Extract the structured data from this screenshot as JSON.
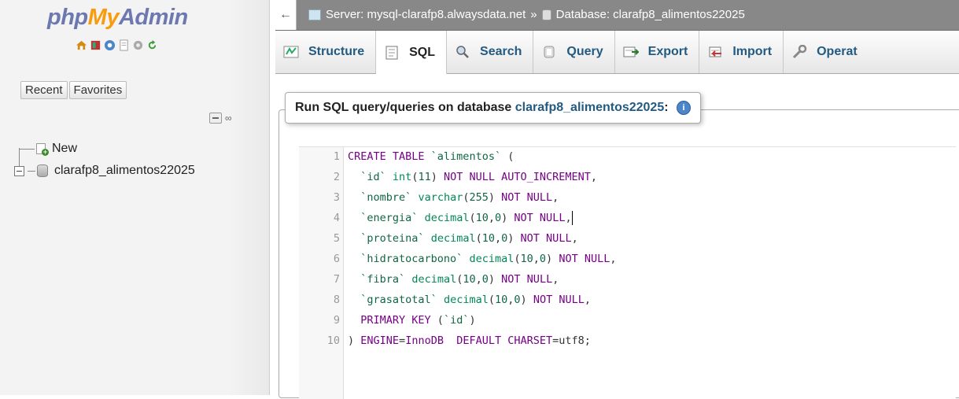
{
  "app": {
    "logo_php": "php",
    "logo_my": "My",
    "logo_admin": "Admin"
  },
  "nav": {
    "icons": [
      "home-icon",
      "database-icon",
      "help-icon",
      "docs-icon",
      "settings-icon",
      "reload-icon"
    ],
    "tabs": [
      {
        "label": "Recent"
      },
      {
        "label": "Favorites"
      }
    ],
    "tree": [
      {
        "label": "New"
      },
      {
        "label": "clarafp8_alimentos22025"
      }
    ]
  },
  "breadcrumb": {
    "server": "Server: mysql-clarafp8.alwaysdata.net",
    "sep": "»",
    "database": "Database: clarafp8_alimentos22025"
  },
  "tabs": [
    {
      "label": "Structure",
      "icon": "structure-icon"
    },
    {
      "label": "SQL",
      "icon": "sql-icon",
      "active": true
    },
    {
      "label": "Search",
      "icon": "search-icon"
    },
    {
      "label": "Query",
      "icon": "query-icon"
    },
    {
      "label": "Export",
      "icon": "export-icon"
    },
    {
      "label": "Import",
      "icon": "import-icon"
    },
    {
      "label": "Operat",
      "icon": "operations-icon"
    }
  ],
  "query_panel": {
    "legend_prefix": "Run SQL query/queries on database ",
    "legend_db": "clarafp8_alimentos22025",
    "legend_suffix": ":"
  },
  "code": [
    {
      "n": "1",
      "parts": [
        [
          "kw",
          "CREATE TABLE "
        ],
        [
          "str",
          "`alimentos`"
        ],
        [
          "pn",
          " ("
        ]
      ]
    },
    {
      "n": "2",
      "parts": [
        [
          "pn",
          "  "
        ],
        [
          "str",
          "`id`"
        ],
        [
          "pn",
          " "
        ],
        [
          "ty",
          "int"
        ],
        [
          "pn",
          "("
        ],
        [
          "num",
          "11"
        ],
        [
          "pn",
          ") "
        ],
        [
          "kw",
          "NOT NULL AUTO_INCREMENT"
        ],
        [
          "pn",
          ","
        ]
      ]
    },
    {
      "n": "3",
      "parts": [
        [
          "pn",
          "  "
        ],
        [
          "str",
          "`nombre`"
        ],
        [
          "pn",
          " "
        ],
        [
          "ty",
          "varchar"
        ],
        [
          "pn",
          "("
        ],
        [
          "num",
          "255"
        ],
        [
          "pn",
          ") "
        ],
        [
          "kw",
          "NOT NULL"
        ],
        [
          "pn",
          ","
        ]
      ]
    },
    {
      "n": "4",
      "parts": [
        [
          "pn",
          "  "
        ],
        [
          "str",
          "`energia`"
        ],
        [
          "pn",
          " "
        ],
        [
          "ty",
          "decimal"
        ],
        [
          "pn",
          "("
        ],
        [
          "num",
          "10"
        ],
        [
          "pn",
          ","
        ],
        [
          "num",
          "0"
        ],
        [
          "pn",
          ") "
        ],
        [
          "kw",
          "NOT NULL"
        ],
        [
          "pn",
          ","
        ]
      ],
      "cursor": true
    },
    {
      "n": "5",
      "parts": [
        [
          "pn",
          "  "
        ],
        [
          "str",
          "`proteina`"
        ],
        [
          "pn",
          " "
        ],
        [
          "ty",
          "decimal"
        ],
        [
          "pn",
          "("
        ],
        [
          "num",
          "10"
        ],
        [
          "pn",
          ","
        ],
        [
          "num",
          "0"
        ],
        [
          "pn",
          ") "
        ],
        [
          "kw",
          "NOT NULL"
        ],
        [
          "pn",
          ","
        ]
      ]
    },
    {
      "n": "6",
      "parts": [
        [
          "pn",
          "  "
        ],
        [
          "str",
          "`hidratocarbono`"
        ],
        [
          "pn",
          " "
        ],
        [
          "ty",
          "decimal"
        ],
        [
          "pn",
          "("
        ],
        [
          "num",
          "10"
        ],
        [
          "pn",
          ","
        ],
        [
          "num",
          "0"
        ],
        [
          "pn",
          ") "
        ],
        [
          "kw",
          "NOT NULL"
        ],
        [
          "pn",
          ","
        ]
      ]
    },
    {
      "n": "7",
      "parts": [
        [
          "pn",
          "  "
        ],
        [
          "str",
          "`fibra`"
        ],
        [
          "pn",
          " "
        ],
        [
          "ty",
          "decimal"
        ],
        [
          "pn",
          "("
        ],
        [
          "num",
          "10"
        ],
        [
          "pn",
          ","
        ],
        [
          "num",
          "0"
        ],
        [
          "pn",
          ") "
        ],
        [
          "kw",
          "NOT NULL"
        ],
        [
          "pn",
          ","
        ]
      ]
    },
    {
      "n": "8",
      "parts": [
        [
          "pn",
          "  "
        ],
        [
          "str",
          "`grasatotal`"
        ],
        [
          "pn",
          " "
        ],
        [
          "ty",
          "decimal"
        ],
        [
          "pn",
          "("
        ],
        [
          "num",
          "10"
        ],
        [
          "pn",
          ","
        ],
        [
          "num",
          "0"
        ],
        [
          "pn",
          ") "
        ],
        [
          "kw",
          "NOT NULL"
        ],
        [
          "pn",
          ","
        ]
      ]
    },
    {
      "n": "9",
      "parts": [
        [
          "pn",
          "  "
        ],
        [
          "kw",
          "PRIMARY KEY"
        ],
        [
          "pn",
          " ("
        ],
        [
          "str",
          "`id`"
        ],
        [
          "pn",
          ")"
        ]
      ]
    },
    {
      "n": "10",
      "parts": [
        [
          "pn",
          ") "
        ],
        [
          "kw",
          "ENGINE"
        ],
        [
          "pn",
          "="
        ],
        [
          "kw",
          "InnoDB"
        ],
        [
          "pn",
          "  "
        ],
        [
          "kw",
          "DEFAULT CHARSET"
        ],
        [
          "pn",
          "="
        ],
        [
          "pn",
          "utf8;"
        ]
      ]
    }
  ],
  "colors": {
    "keyword": "#770088",
    "string": "#116644",
    "type": "#008855",
    "topbar": "#888888",
    "link": "#235a81"
  }
}
